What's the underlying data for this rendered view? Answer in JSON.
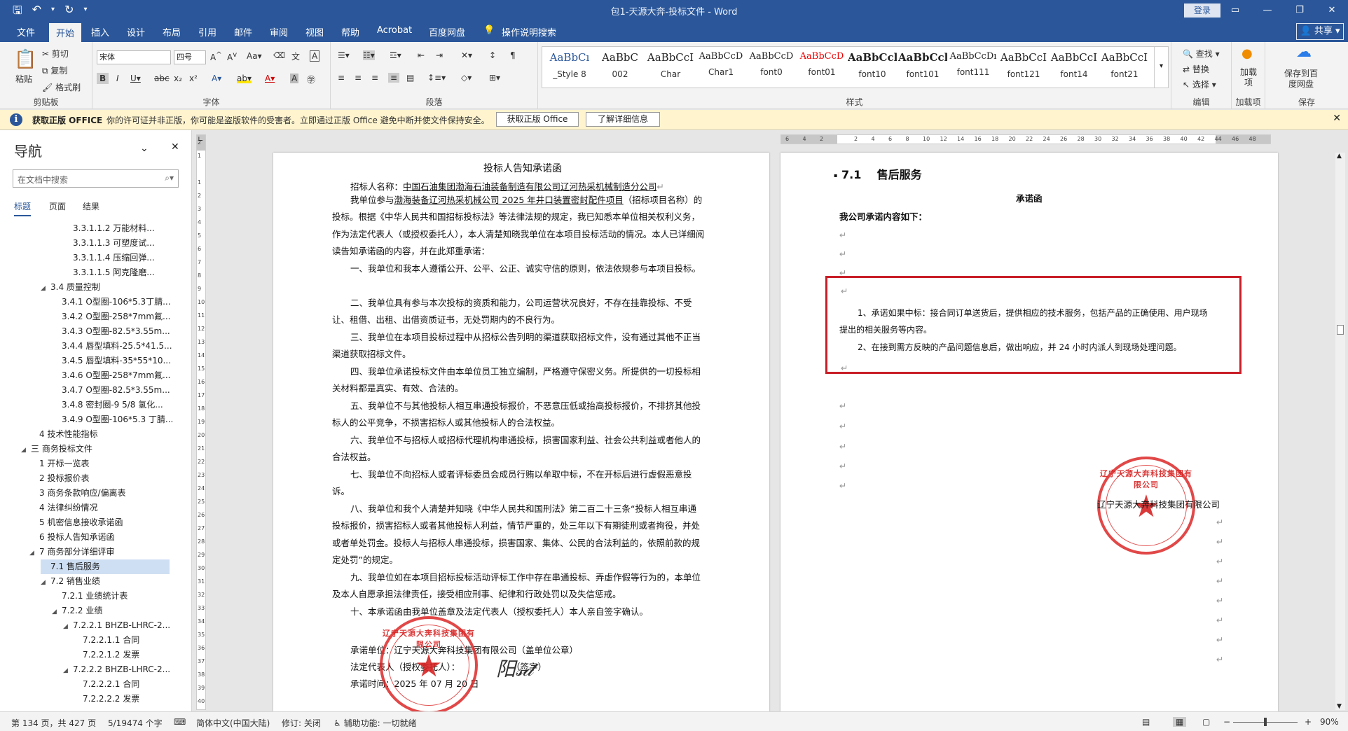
{
  "window": {
    "title": "包1-天源大奔-投标文件 - Word",
    "login": "登录",
    "share": "共享"
  },
  "tabs": [
    "文件",
    "开始",
    "插入",
    "设计",
    "布局",
    "引用",
    "邮件",
    "审阅",
    "视图",
    "帮助",
    "Acrobat",
    "百度网盘",
    "操作说明搜索"
  ],
  "ribbon": {
    "clipboard": {
      "paste": "粘贴",
      "cut": "剪切",
      "copy": "复制",
      "format_painter": "格式刷",
      "label": "剪贴板"
    },
    "font": {
      "name": "宋体",
      "size": "四号",
      "label": "字体"
    },
    "paragraph": {
      "label": "段落"
    },
    "styles": {
      "label": "样式",
      "items": [
        {
          "preview": "AaBbCı",
          "name": "_Style 8"
        },
        {
          "preview": "AaBbC",
          "name": "002"
        },
        {
          "preview": "AaBbCcI",
          "name": "Char"
        },
        {
          "preview": "AaBbCcD",
          "name": "Char1"
        },
        {
          "preview": "AaBbCcD",
          "name": "font0"
        },
        {
          "preview": "AaBbCcD",
          "name": "font01"
        },
        {
          "preview": "AaBbCcl",
          "name": "font10"
        },
        {
          "preview": "AaBbCcl",
          "name": "font101"
        },
        {
          "preview": "AaBbCcDı",
          "name": "font111"
        },
        {
          "preview": "AaBbCcI",
          "name": "font121"
        },
        {
          "preview": "AaBbCcI",
          "name": "font14"
        },
        {
          "preview": "AaBbCcI",
          "name": "font21"
        }
      ]
    },
    "editing": {
      "find": "查找",
      "replace": "替换",
      "select": "选择",
      "label": "编辑"
    },
    "addins": {
      "add": "加载项",
      "label": "加载项"
    },
    "save": {
      "save_to": "保存到百度网盘",
      "label": "保存"
    }
  },
  "infobar": {
    "title": "获取正版 OFFICE",
    "message": "你的许可证并非正版，你可能是盗版软件的受害者。立即通过正版 Office 避免中断并使文件保持安全。",
    "btn1": "获取正版 Office",
    "btn2": "了解详细信息"
  },
  "nav": {
    "title": "导航",
    "search_placeholder": "在文档中搜索",
    "tabs": [
      "标题",
      "页面",
      "结果"
    ],
    "items": [
      {
        "label": "3.3.1.1.2 万能材料...",
        "level": 4,
        "arrow": ""
      },
      {
        "label": "3.3.1.1.3 可塑度试...",
        "level": 4,
        "arrow": ""
      },
      {
        "label": "3.3.1.1.4 压缩回弹...",
        "level": 4,
        "arrow": ""
      },
      {
        "label": "3.3.1.1.5 阿克隆磨...",
        "level": 4,
        "arrow": ""
      },
      {
        "label": "3.4 质量控制",
        "level": 2,
        "arrow": "◢"
      },
      {
        "label": "3.4.1 O型圈-106*5.3丁腈...",
        "level": 3,
        "arrow": ""
      },
      {
        "label": "3.4.2 O型圈-258*7mm氟...",
        "level": 3,
        "arrow": ""
      },
      {
        "label": "3.4.3 O型圈-82.5*3.55m...",
        "level": 3,
        "arrow": ""
      },
      {
        "label": "3.4.4 唇型填料-25.5*41.5...",
        "level": 3,
        "arrow": ""
      },
      {
        "label": "3.4.5 唇型填料-35*55*10...",
        "level": 3,
        "arrow": ""
      },
      {
        "label": "3.4.6 O型圈-258*7mm氟...",
        "level": 3,
        "arrow": ""
      },
      {
        "label": "3.4.7 O型圈-82.5*3.55m...",
        "level": 3,
        "arrow": ""
      },
      {
        "label": "3.4.8 密封圈-9 5/8 氢化...",
        "level": 3,
        "arrow": ""
      },
      {
        "label": "3.4.9 O型圈-106*5.3 丁腈...",
        "level": 3,
        "arrow": ""
      },
      {
        "label": "4 技术性能指标",
        "level": 1,
        "arrow": ""
      },
      {
        "label": "三 商务投标文件",
        "level": 0,
        "arrow": "◢"
      },
      {
        "label": "1 开标一览表",
        "level": 1,
        "arrow": ""
      },
      {
        "label": "2 投标报价表",
        "level": 1,
        "arrow": ""
      },
      {
        "label": "3 商务条款响应/偏离表",
        "level": 1,
        "arrow": ""
      },
      {
        "label": "4 法律纠纷情况",
        "level": 1,
        "arrow": ""
      },
      {
        "label": "5 机密信息接收承诺函",
        "level": 1,
        "arrow": ""
      },
      {
        "label": "6 投标人告知承诺函",
        "level": 1,
        "arrow": ""
      },
      {
        "label": "7 商务部分详细评审",
        "level": 1,
        "arrow": "◢"
      },
      {
        "label": "7.1 售后服务",
        "level": 2,
        "arrow": "",
        "selected": true
      },
      {
        "label": "7.2 销售业绩",
        "level": 2,
        "arrow": "◢"
      },
      {
        "label": "7.2.1 业绩统计表",
        "level": 3,
        "arrow": ""
      },
      {
        "label": "7.2.2 业绩",
        "level": 3,
        "arrow": "◢"
      },
      {
        "label": "7.2.2.1 BHZB-LHRC-2...",
        "level": 4,
        "arrow": "◢"
      },
      {
        "label": "7.2.2.1.1 合同",
        "level": 5,
        "arrow": ""
      },
      {
        "label": "7.2.2.1.2 发票",
        "level": 5,
        "arrow": ""
      },
      {
        "label": "7.2.2.2 BHZB-LHRC-2...",
        "level": 4,
        "arrow": "◢"
      },
      {
        "label": "7.2.2.2.1 合同",
        "level": 5,
        "arrow": ""
      },
      {
        "label": "7.2.2.2.2 发票",
        "level": 5,
        "arrow": ""
      }
    ]
  },
  "left_page": {
    "title": "投标人告知承诺函",
    "recipient_label": "招标人名称：",
    "recipient": "中国石油集团渤海石油装备制造有限公司辽河热采机械制造分公司",
    "p1_pre": "我单位参与",
    "p1_project": "渤海装备辽河热采机械公司 2025 年井口装置密封配件项目",
    "p1_post": "（招标项目名称）的投标。根据《中华人民共和国招标投标法》等法律法规的规定，我已知悉本单位相关权利义务，作为法定代表人（或授权委托人），本人清楚知晓我单位在本项目投标活动的情况。本人已详细阅读告知承诺函的内容，并在此郑重承诺：",
    "items": [
      "一、我单位和我本人遵循公开、公平、公正、诚实守信的原则，依法依规参与本项目投标。",
      "二、我单位具有参与本次投标的资质和能力，公司运营状况良好，不存在挂靠投标、不受让、租借、出租、出借资质证书，无处罚期内的不良行为。",
      "三、我单位在本项目投标过程中从招标公告列明的渠道获取招标文件，没有通过其他不正当渠道获取招标文件。",
      "四、我单位承诺投标文件由本单位员工独立编制，严格遵守保密义务。所提供的一切投标相关材料都是真实、有效、合法的。",
      "五、我单位不与其他投标人相互串通投标报价，不恶意压低或抬高投标报价，不排挤其他投标人的公平竞争，不损害招标人或其他投标人的合法权益。",
      "六、我单位不与招标人或招标代理机构串通投标，损害国家利益、社会公共利益或者他人的合法权益。",
      "七、我单位不向招标人或者评标委员会成员行贿以牟取中标，不在开标后进行虚假恶意投诉。",
      "八、我单位和我个人清楚并知晓《中华人民共和国刑法》第二百二十三条“投标人相互串通投标报价，损害招标人或者其他投标人利益，情节严重的，处三年以下有期徒刑或者拘役，并处或者单处罚金。投标人与招标人串通投标，损害国家、集体、公民的合法利益的，依照前款的规定处罚”的规定。",
      "九、我单位如在本项目招标投标活动评标工作中存在串通投标、弄虚作假等行为的，本单位及本人自愿承担法律责任，接受相应刑事、纪律和行政处罚以及失信惩戒。",
      "十、本承诺函由我单位盖章及法定代表人（授权委托人）本人亲自签字确认。"
    ],
    "unit": "承诺单位：辽宁天源大奔科技集团有限公司（盖单位公章）",
    "rep": "法定代表人（授权委托人）：",
    "sign_label": "（签字）",
    "date": "承诺时间：2025 年 07 月 20 日"
  },
  "right_page": {
    "heading_num": "7.1",
    "heading": "售后服务",
    "title": "承诺函",
    "intro": "我公司承诺内容如下：",
    "item1": "1、承诺如果中标：接合同订单送货后，提供相应的技术服务，包括产品的正确使用、用户现场提出的相关服务等内容。",
    "item2": "2、在接到需方反映的产品问题信息后，做出响应，并 24 小时内派人到现场处理问题。",
    "company": "辽宁天源大奔科技集团有限公司"
  },
  "seal": {
    "text": "辽宁天源大奔科技集团有限公司",
    "text_en": "LIAONING TIANYUAN DABEN TECHNOLOGY GROUP CO.,LTD",
    "code": "2114080007379"
  },
  "paragraph_mark": "↵",
  "ruler_h": [
    "6",
    "4",
    "2",
    "",
    "2",
    "4",
    "6",
    "8",
    "10",
    "12",
    "14",
    "16",
    "18",
    "20",
    "22",
    "24",
    "26",
    "28",
    "30",
    "32",
    "34",
    "36",
    "38",
    "40",
    "42",
    "44",
    "46",
    "48"
  ],
  "ruler_v": [
    "2",
    "1",
    "",
    "1",
    "2",
    "3",
    "4",
    "5",
    "6",
    "7",
    "8",
    "9",
    "10",
    "11",
    "12",
    "13",
    "14",
    "15",
    "16",
    "17",
    "18",
    "19",
    "20",
    "21",
    "22",
    "23",
    "24",
    "25",
    "26",
    "27",
    "28",
    "29",
    "30",
    "31",
    "32",
    "33",
    "34",
    "35",
    "36",
    "37",
    "38",
    "39",
    "40"
  ],
  "status": {
    "page": "第 134 页，共 427 页",
    "words": "5/19474 个字",
    "lang": "简体中文(中国大陆)",
    "track": "修订: 关闭",
    "access": "辅助功能: 一切就绪",
    "zoom": "90%"
  },
  "colors": {
    "brand": "#2b579a",
    "highlight_box": "#c81e28",
    "seal": "#dc2828"
  }
}
